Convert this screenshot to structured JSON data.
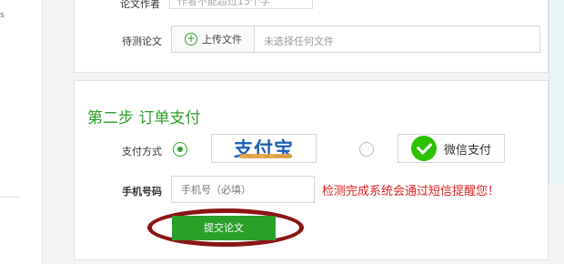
{
  "sidebar": {
    "glyph": "s"
  },
  "form": {
    "author": {
      "label": "论文作者",
      "placeholder": "作者不能超过15个字"
    },
    "upload": {
      "label": "待测论文",
      "button_label": "上传文件",
      "file_status": "未选择任何文件"
    }
  },
  "step2": {
    "title": "第二步 订单支付",
    "payment": {
      "label": "支付方式",
      "selected": "alipay",
      "alipay_logo_text": "支付宝",
      "wechat_label": "微信支付"
    },
    "phone": {
      "label": "手机号码",
      "placeholder": "手机号（必填）",
      "notice": "检测完成系统会通过短信提醒您！"
    },
    "submit_label": "提交论文"
  },
  "colors": {
    "accent_green": "#2aa02a",
    "notice_red": "#e02020",
    "annotation_ring": "#8b1414",
    "alipay_blue": "#1a5fb4",
    "wechat_green": "#2dc100"
  }
}
